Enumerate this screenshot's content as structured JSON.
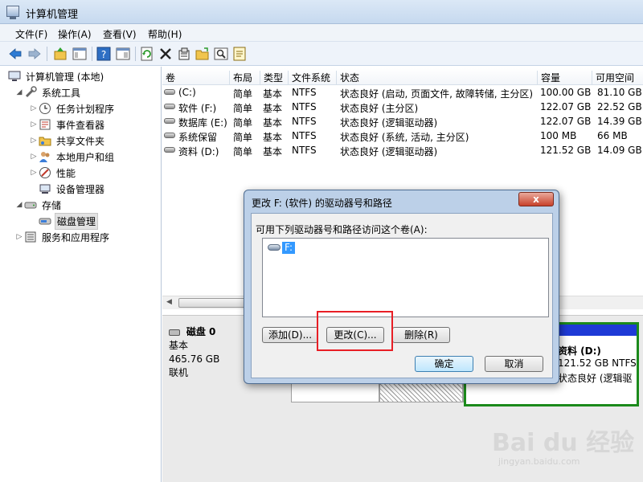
{
  "window": {
    "title": "计算机管理"
  },
  "menu": [
    "文件(F)",
    "操作(A)",
    "查看(V)",
    "帮助(H)"
  ],
  "toolbar": [
    "back-icon",
    "forward-icon",
    "up-icon",
    "show-hide-tree-icon",
    "help-icon",
    "console-icon",
    "refresh-icon",
    "delete-icon",
    "properties-icon",
    "open-icon",
    "search-icon",
    "export-icon"
  ],
  "tree": {
    "root": "计算机管理 (本地)",
    "system_tools": "系统工具",
    "task_scheduler": "任务计划程序",
    "event_viewer": "事件查看器",
    "shared_folders": "共享文件夹",
    "local_users": "本地用户和组",
    "performance": "性能",
    "device_manager": "设备管理器",
    "storage": "存储",
    "disk_management": "磁盘管理",
    "services_apps": "服务和应用程序"
  },
  "volumes": {
    "headers": [
      "卷",
      "布局",
      "类型",
      "文件系统",
      "状态",
      "容量",
      "可用空间"
    ],
    "rows": [
      [
        "(C:)",
        "简单",
        "基本",
        "NTFS",
        "状态良好 (启动, 页面文件, 故障转储, 主分区)",
        "100.00 GB",
        "81.10 GB"
      ],
      [
        "软件 (F:)",
        "简单",
        "基本",
        "NTFS",
        "状态良好 (主分区)",
        "122.07 GB",
        "22.52 GB"
      ],
      [
        "数据库 (E:)",
        "简单",
        "基本",
        "NTFS",
        "状态良好 (逻辑驱动器)",
        "122.07 GB",
        "14.39 GB"
      ],
      [
        "系统保留",
        "简单",
        "基本",
        "NTFS",
        "状态良好 (系统, 活动, 主分区)",
        "100 MB",
        "66 MB"
      ],
      [
        "资料 (D:)",
        "简单",
        "基本",
        "NTFS",
        "状态良好 (逻辑驱动器)",
        "121.52 GB",
        "14.09 GB"
      ]
    ]
  },
  "disk": {
    "name": "磁盘 0",
    "type": "基本",
    "size": "465.76 GB",
    "status": "联机",
    "partition_label": "资料  (D:)",
    "partition_size": "121.52 GB NTFS",
    "partition_status": "状态良好 (逻辑驱"
  },
  "dialog": {
    "title": "更改 F: (软件) 的驱动器号和路径",
    "close": "x",
    "prompt": "可用下列驱动器号和路径访问这个卷(A):",
    "list_item": "F:",
    "add": "添加(D)...",
    "change": "更改(C)...",
    "remove": "删除(R)",
    "ok": "确定",
    "cancel": "取消"
  },
  "watermark": {
    "main": "Bai du 经验",
    "sub": "jingyan.baidu.com"
  }
}
